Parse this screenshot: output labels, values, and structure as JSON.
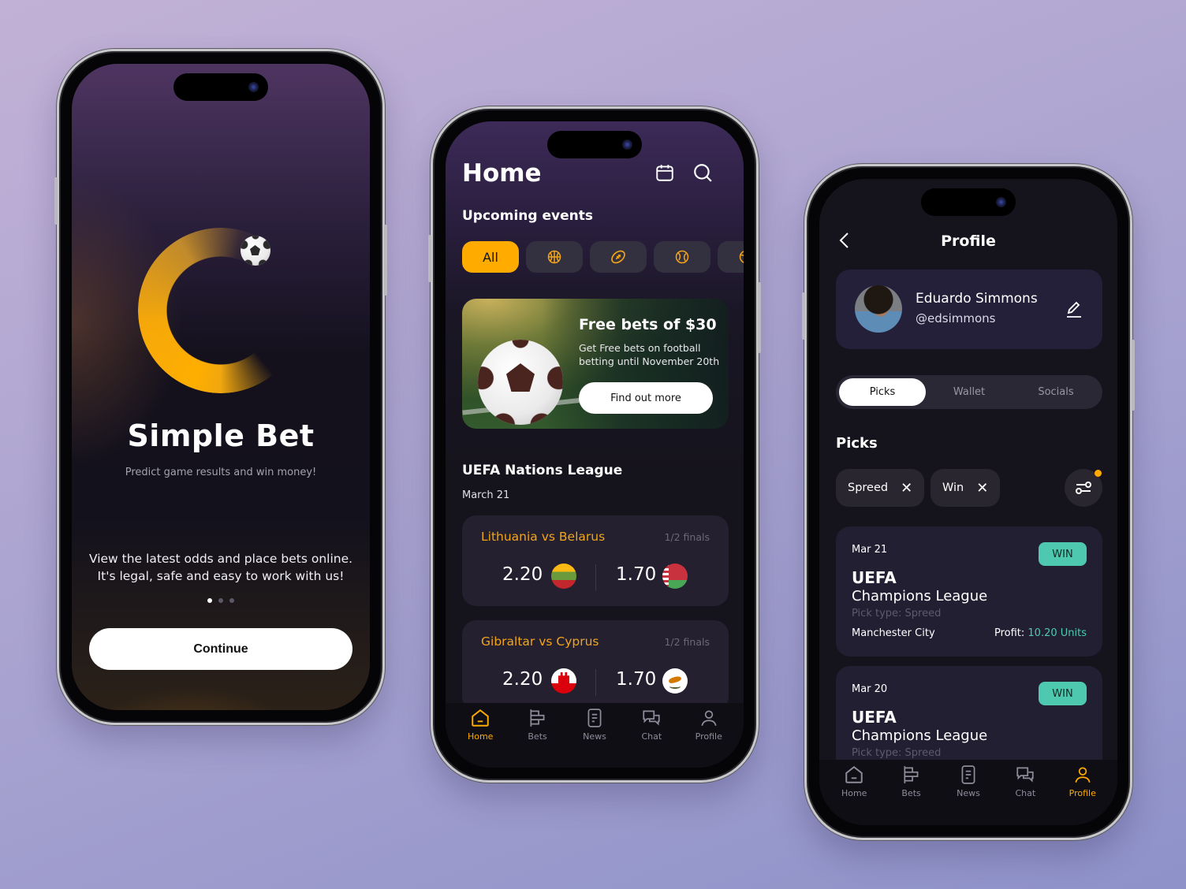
{
  "onboarding": {
    "app_title": "Simple Bet",
    "tagline": "Predict game results and win money!",
    "description_line1": "View the latest odds and place bets online.",
    "description_line2": "It's legal, safe and easy to work with us!",
    "pagination": {
      "total": 3,
      "current": 1
    },
    "continue_label": "Continue",
    "accent_color": "#ffab00"
  },
  "home": {
    "title": "Home",
    "header_icons": [
      "calendar-icon",
      "search-icon"
    ],
    "upcoming_title": "Upcoming events",
    "sport_filters": [
      {
        "label": "All",
        "active": true
      },
      {
        "icon": "basketball-icon"
      },
      {
        "icon": "american-football-icon"
      },
      {
        "icon": "baseball-icon"
      },
      {
        "icon": "volleyball-icon"
      }
    ],
    "promo": {
      "title": "Free bets of $30",
      "text": "Get Free bets on football betting until November 20th",
      "button_label": "Find out more"
    },
    "league": {
      "title": "UEFA Nations League",
      "date": "March 21",
      "matches": [
        {
          "name": "Lithuania vs Belarus",
          "stage": "1/2 finals",
          "odd_home": "2.20",
          "odd_away": "1.70",
          "flag_home": "lithuania",
          "flag_away": "belarus"
        },
        {
          "name": "Gibraltar vs Cyprus",
          "stage": "1/2 finals",
          "odd_home": "2.20",
          "odd_away": "1.70",
          "flag_home": "gibraltar",
          "flag_away": "cyprus"
        }
      ]
    },
    "tabbar": [
      {
        "label": "Home",
        "active": true
      },
      {
        "label": "Bets"
      },
      {
        "label": "News"
      },
      {
        "label": "Chat"
      },
      {
        "label": "Profile"
      }
    ]
  },
  "profile": {
    "title": "Profile",
    "user": {
      "name": "Eduardo Simmons",
      "handle": "@edsimmons"
    },
    "segments": [
      {
        "label": "Picks",
        "active": true
      },
      {
        "label": "Wallet"
      },
      {
        "label": "Socials"
      }
    ],
    "picks_title": "Picks",
    "filters": [
      {
        "label": "Spreed",
        "remove": "✕"
      },
      {
        "label": "Win",
        "remove": "✕"
      }
    ],
    "picks": [
      {
        "date": "Mar 21",
        "status": "WIN",
        "line1": "UEFA",
        "line2": "Champions League",
        "pick_type": "Pick type: Spreed",
        "team": "Manchester City",
        "profit_label": "Profit:",
        "profit_value": "10.20 Units"
      },
      {
        "date": "Mar 20",
        "status": "WIN",
        "line1": "UEFA",
        "line2": "Champions League",
        "pick_type": "Pick type: Spreed"
      }
    ],
    "tabbar": [
      {
        "label": "Home"
      },
      {
        "label": "Bets"
      },
      {
        "label": "News"
      },
      {
        "label": "Chat"
      },
      {
        "label": "Profile",
        "active": true
      }
    ],
    "win_color": "#4ec9b0"
  }
}
